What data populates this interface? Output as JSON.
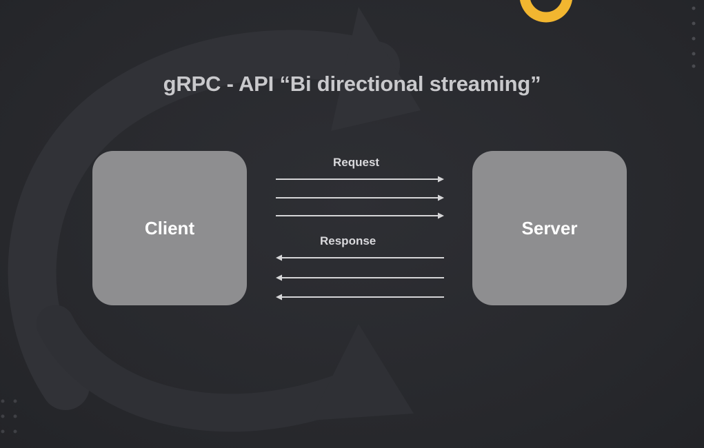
{
  "title": "gRPC - API “Bi directional streaming”",
  "client": {
    "label": "Client"
  },
  "server": {
    "label": "Server"
  },
  "request": {
    "label": "Request",
    "count": 3
  },
  "response": {
    "label": "Response",
    "count": 3
  },
  "colors": {
    "background": "#2a2b30",
    "box": "#8e8e90",
    "arrow": "#d6d6d8",
    "logo_accent": "#f2b630"
  }
}
